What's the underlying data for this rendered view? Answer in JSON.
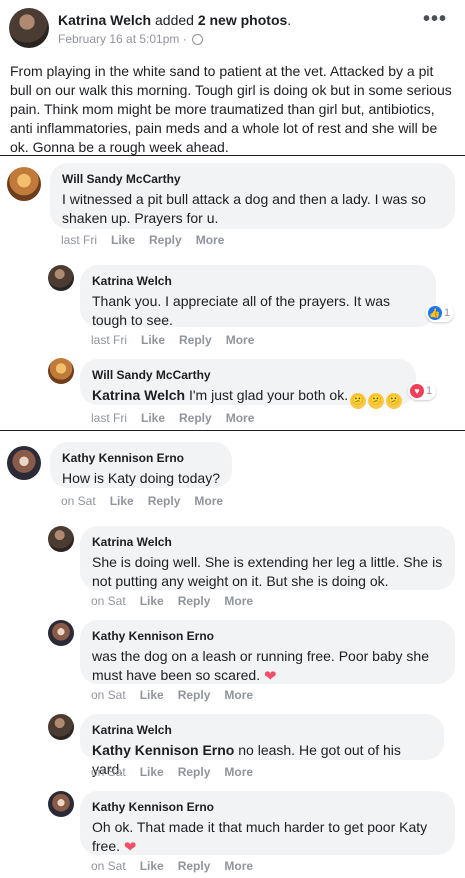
{
  "post": {
    "author": "Katrina Welch",
    "action_prefix": "added",
    "action_strong": "2 new photos",
    "action_suffix": ".",
    "timestamp": "February 16 at 5:01pm · ",
    "privacy_icon": "globe-icon",
    "more": "•••",
    "body": "From playing in the white sand to patient at the vet. Attacked by a pit bull on our walk this morning. Tough girl is doing ok but in some serious pain. Think mom might be more traumatized than girl but, antibiotics, anti inflammatories, pain meds and a whole lot of rest and she will be ok. Gonna be a rough week ahead."
  },
  "comments": [
    {
      "name": "Will Sandy McCarthy",
      "text": "I witnessed a pit bull attack a dog and then a lady. I was so shaken up. Prayers for u.",
      "time": "last Fri",
      "like": "Like",
      "reply": "Reply",
      "more": "More"
    },
    {
      "name": "Katrina Welch",
      "text": "Thank you. I appreciate all of the prayers. It was tough to see.",
      "time": "last Fri",
      "like": "Like",
      "reply": "Reply",
      "more": "More",
      "reaction": {
        "icon": "like-icon",
        "count": "1"
      }
    },
    {
      "name": "Will Sandy McCarthy",
      "mention": "Katrina Welch",
      "text": " I'm just glad your both ok.",
      "emoji": [
        "😕",
        "😕",
        "😕"
      ],
      "time": "last Fri",
      "like": "Like",
      "reply": "Reply",
      "more": "More",
      "reaction": {
        "icon": "heart-icon",
        "count": "1"
      }
    },
    {
      "name": "Kathy Kennison Erno",
      "text": "How is Katy doing today?",
      "time": "on Sat",
      "like": "Like",
      "reply": "Reply",
      "more": "More"
    },
    {
      "name": "Katrina Welch",
      "text": "She is doing well. She is extending her leg a little. She is not putting any weight on it. But she is doing ok.",
      "time": "on Sat",
      "like": "Like",
      "reply": "Reply",
      "more": "More"
    },
    {
      "name": "Kathy Kennison Erno",
      "text": "was the dog on a leash or running free. Poor baby she must have been so scared.",
      "heart": "❤",
      "time": "on Sat",
      "like": "Like",
      "reply": "Reply",
      "more": "More"
    },
    {
      "name": "Katrina Welch",
      "mention": "Kathy Kennison Erno",
      "text": " no leash. He got out of his yard.",
      "time": "on Sat",
      "like": "Like",
      "reply": "Reply",
      "more": "More"
    },
    {
      "name": "Kathy Kennison Erno",
      "text": "Oh ok. That made it that much harder to get poor Katy free.",
      "heart": "❤",
      "time": "on Sat",
      "like": "Like",
      "reply": "Reply",
      "more": "More"
    }
  ]
}
